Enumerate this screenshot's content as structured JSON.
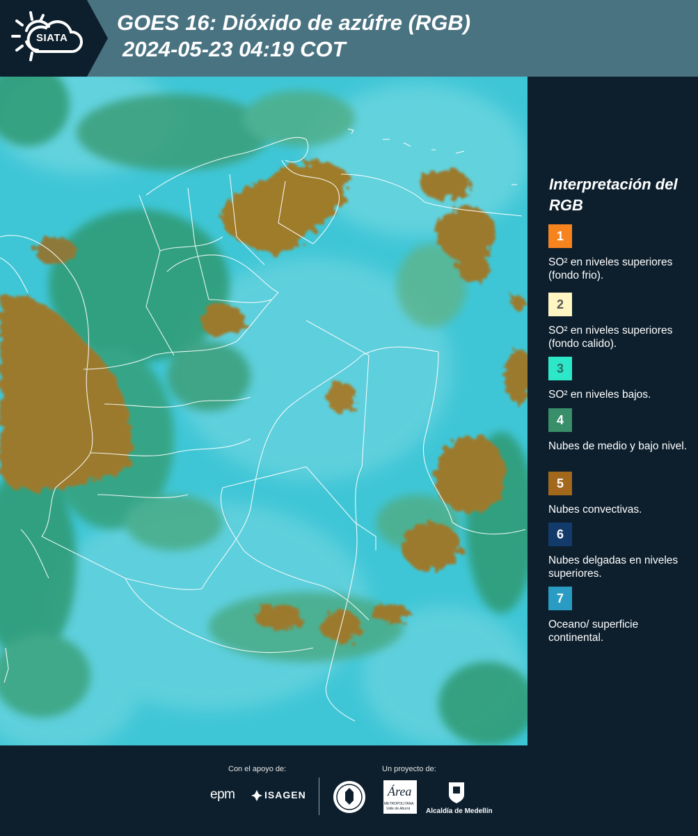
{
  "header": {
    "logo_text": "SIATA",
    "title_line1": "GOES 16: Dióxido de azúfre (RGB)",
    "title_line2": "2024-05-23 04:19 COT"
  },
  "legend": {
    "title": "Interpretación del RGB",
    "items": [
      {
        "number": "1",
        "color": "#f5841f",
        "number_color": "#ffffff",
        "text": "SO² en niveles superiores (fondo frio)."
      },
      {
        "number": "2",
        "color": "#fff6c2",
        "number_color": "#555555",
        "text": "SO² en niveles superiores (fondo calido)."
      },
      {
        "number": "3",
        "color": "#2de8c8",
        "number_color": "#2a6d66",
        "text": "SO² en niveles bajos."
      },
      {
        "number": "4",
        "color": "#3a8f6b",
        "number_color": "#ffffff",
        "text": "Nubes de medio y bajo nivel."
      },
      {
        "number": "5",
        "color": "#a2691c",
        "number_color": "#ffffff",
        "text": "Nubes convectivas."
      },
      {
        "number": "6",
        "color": "#123b6c",
        "number_color": "#ffffff",
        "text": "Nubes delgadas en niveles superiores."
      },
      {
        "number": "7",
        "color": "#2a9cc4",
        "number_color": "#ffffff",
        "text": "Oceano/ superficie continental."
      }
    ]
  },
  "footer": {
    "support_label": "Con el apoyo de:",
    "project_label": "Un proyecto de:",
    "sponsors": {
      "epm": "epm",
      "isagen": "ISAGEN",
      "area_top": "Área",
      "area_bottom": "METROPOLITANA",
      "area_sub": "Valle de Aburrá",
      "alcaldia": "Alcaldía de Medellín"
    }
  },
  "map_colors": {
    "ocean": "#3fc6d6",
    "haze": "#6fd6df",
    "low_cloud": "#2f9a72",
    "convective": "#9b7a2e",
    "border": "#ffffff"
  }
}
